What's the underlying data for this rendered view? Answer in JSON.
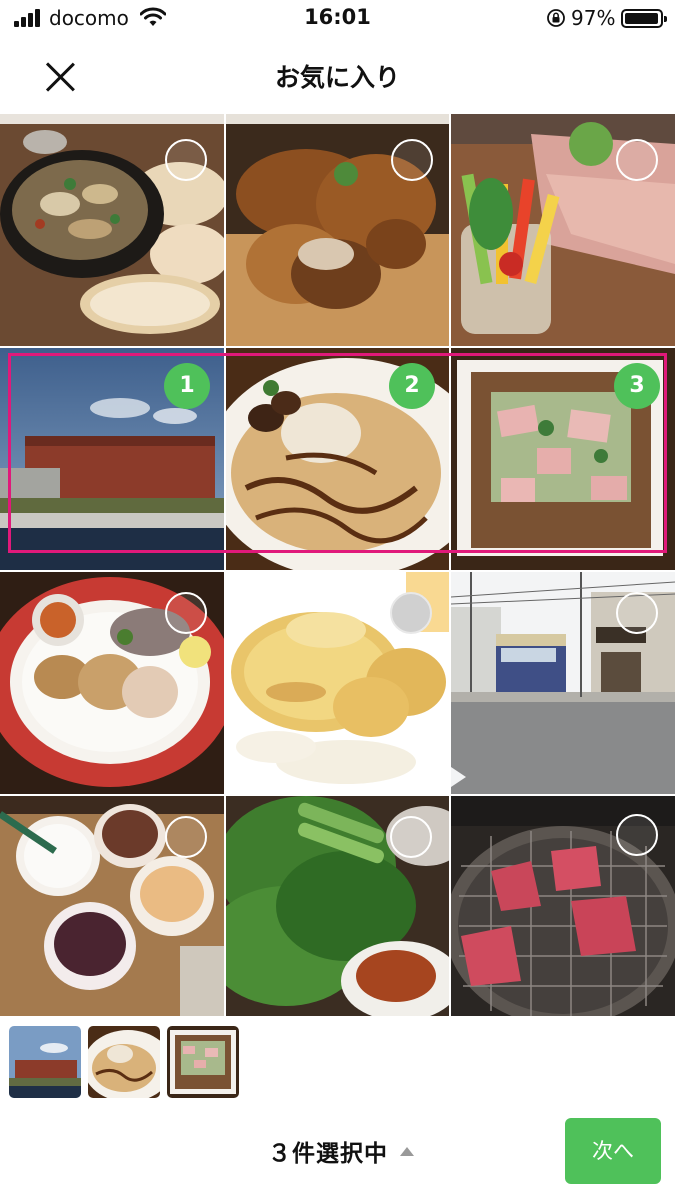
{
  "status_bar": {
    "carrier": "docomo",
    "time": "16:01",
    "battery_percent": "97%",
    "battery_level": 0.97,
    "icons": [
      "signal-icon",
      "wifi-icon",
      "orientation-lock-icon",
      "battery-icon"
    ]
  },
  "header": {
    "title": "お気に入り",
    "close_icon": "close-icon"
  },
  "grid": {
    "photos": [
      {
        "subject": "ajillo-with-bread",
        "selected": false
      },
      {
        "subject": "roast-chicken",
        "selected": false
      },
      {
        "subject": "vegetable-sticks-and-prosciutto",
        "selected": false
      },
      {
        "subject": "red-brick-warehouse",
        "selected": true,
        "order": "1"
      },
      {
        "subject": "crepe-with-ice-cream",
        "selected": true,
        "order": "2"
      },
      {
        "subject": "galette",
        "selected": true,
        "order": "3"
      },
      {
        "subject": "chicken-plate",
        "selected": false
      },
      {
        "subject": "pancakes",
        "selected": false
      },
      {
        "subject": "enoden-tram-street",
        "selected": false
      },
      {
        "subject": "frappuccinos",
        "selected": false
      },
      {
        "subject": "perilla-leaves",
        "selected": false
      },
      {
        "subject": "yakiniku-grill",
        "selected": false
      }
    ]
  },
  "selection": {
    "count_label": "３件選択中",
    "next_label": "次へ",
    "thumbnails": [
      "red-brick-warehouse",
      "crepe-with-ice-cream",
      "galette"
    ]
  },
  "colors": {
    "accent_green": "#4fc15a",
    "highlight_magenta": "#e0197a"
  }
}
